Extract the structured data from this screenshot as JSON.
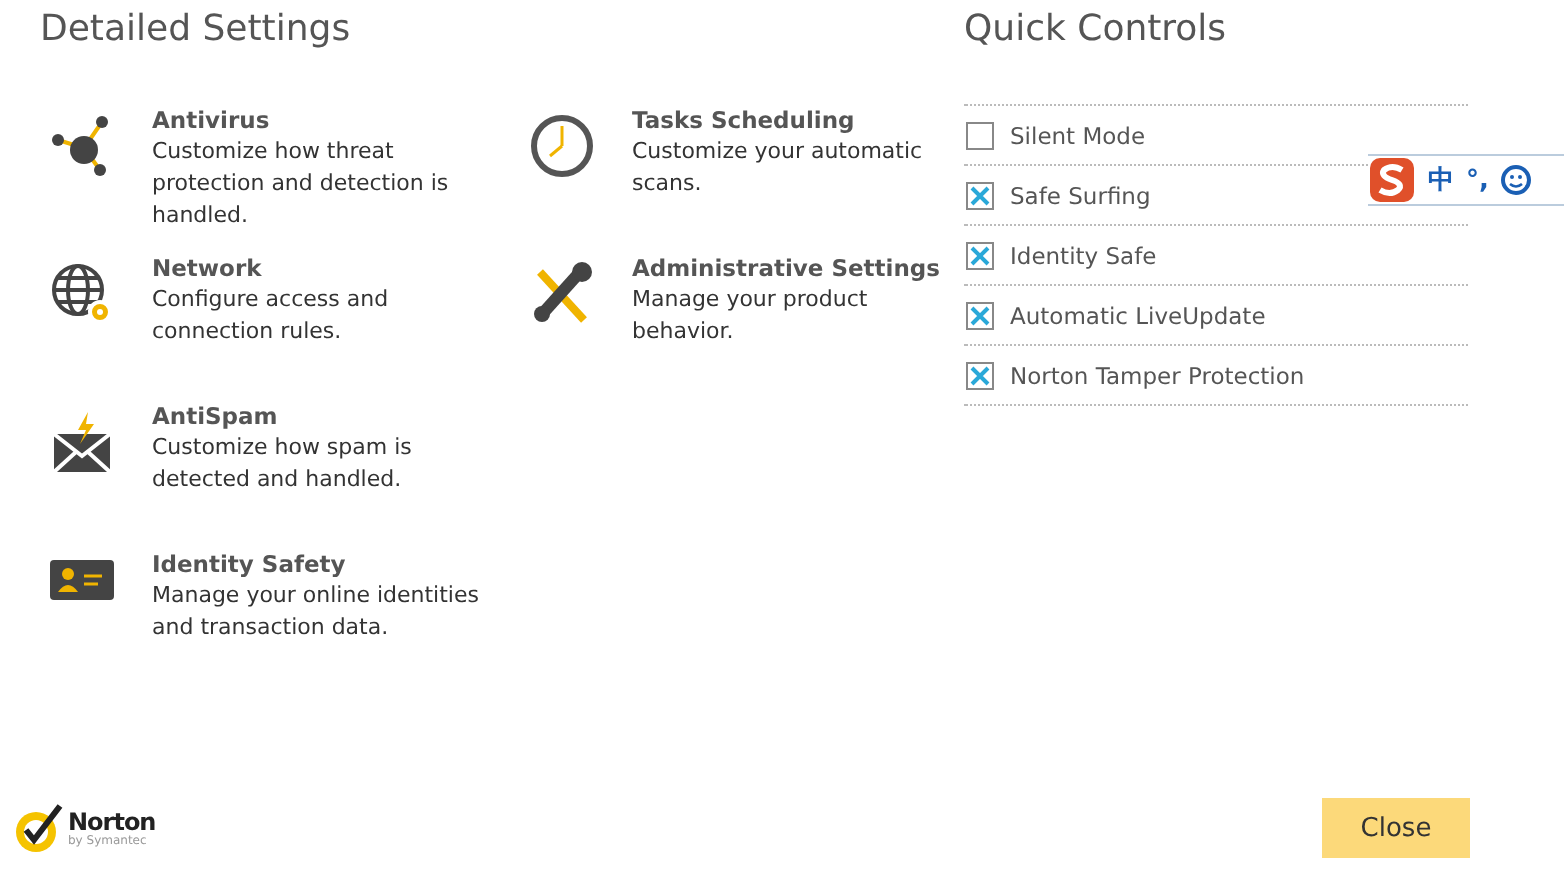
{
  "detailed_settings": {
    "title": "Detailed Settings",
    "items": [
      {
        "kind": "antivirus",
        "title": "Antivirus",
        "description": "Customize how threat protection and detection is handled."
      },
      {
        "kind": "network",
        "title": "Network",
        "description": "Configure access and connection rules."
      },
      {
        "kind": "antispam",
        "title": "AntiSpam",
        "description": "Customize how spam is detected and handled."
      },
      {
        "kind": "identity",
        "title": "Identity Safety",
        "description": "Manage your online identities and transaction data."
      },
      {
        "kind": "tasks",
        "title": "Tasks Scheduling",
        "description": "Customize your automatic scans."
      },
      {
        "kind": "admin",
        "title": "Administrative Settings",
        "description": "Manage your product behavior."
      }
    ]
  },
  "quick_controls": {
    "title": "Quick Controls",
    "items": [
      {
        "label": "Silent Mode",
        "checked": false
      },
      {
        "label": "Safe Surfing",
        "checked": true
      },
      {
        "label": "Identity Safe",
        "checked": true
      },
      {
        "label": "Automatic LiveUpdate",
        "checked": true
      },
      {
        "label": "Norton Tamper Protection",
        "checked": true
      }
    ]
  },
  "ime_toolbar": {
    "language": "中",
    "punctuation": "°,"
  },
  "footer": {
    "logo": {
      "name": "Norton",
      "tagline": "by Symantec"
    },
    "close_button": "Close"
  }
}
